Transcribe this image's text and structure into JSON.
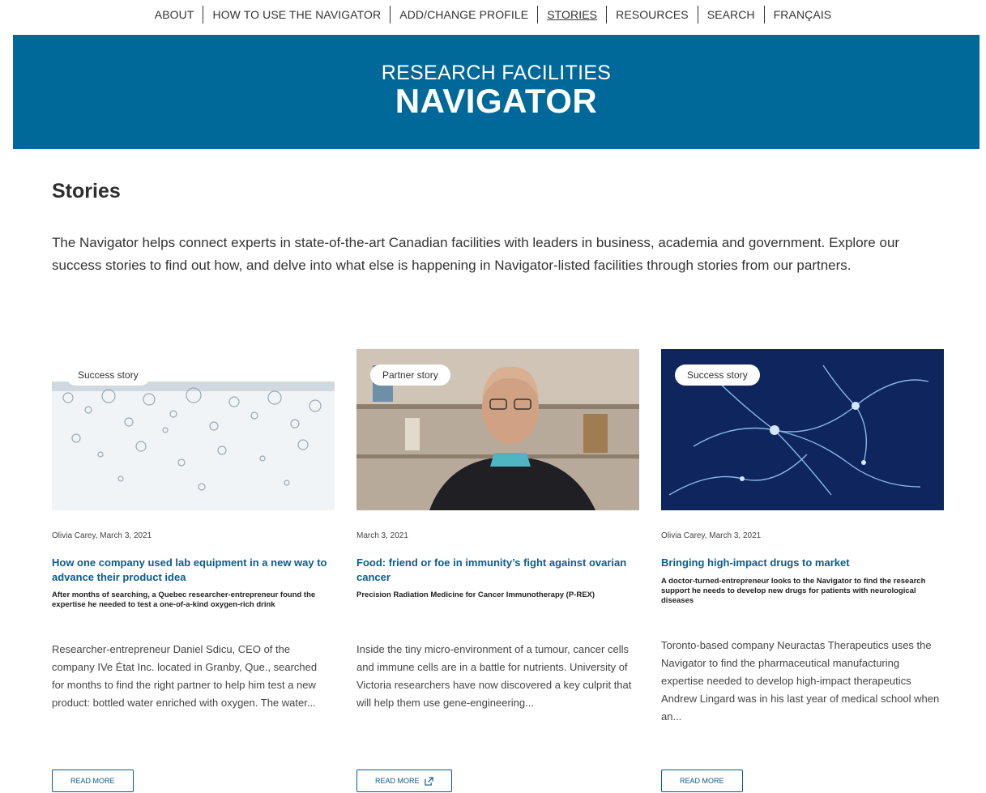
{
  "nav": {
    "items": [
      {
        "label": "ABOUT",
        "active": false
      },
      {
        "label": "HOW TO USE THE NAVIGATOR",
        "active": false
      },
      {
        "label": "ADD/CHANGE PROFILE",
        "active": false
      },
      {
        "label": "STORIES",
        "active": true
      },
      {
        "label": "RESOURCES",
        "active": false
      },
      {
        "label": "SEARCH",
        "active": false
      },
      {
        "label": "FRANÇAIS",
        "active": false
      }
    ]
  },
  "banner": {
    "line1": "RESEARCH FACILITIES",
    "line2": "NAVIGATOR",
    "color": "#00699a"
  },
  "page": {
    "title": "Stories",
    "intro": "The Navigator helps connect experts in state-of-the-art Canadian facilities with leaders in business, academia and government. Explore our success stories to find out how, and delve into what else is happening in Navigator-listed facilities through stories from our partners."
  },
  "cards": [
    {
      "badge": "Success story",
      "image": "water-bubbles-image",
      "meta": "Olivia Carey, March 3, 2021",
      "title": "How one company used lab equipment in a new way to advance their product idea",
      "subtitle": "After months of searching, a Quebec researcher-entrepreneur found the expertise he needed to test a one-of-a-kind oxygen-rich drink",
      "excerpt": "Researcher-entrepreneur Daniel Sdicu, CEO of the company IVe État Inc. located in Granby, Que., searched for months to find the right partner to help him test a new product: bottled water enriched with oxygen. The water...",
      "read_more": "READ MORE",
      "external": false
    },
    {
      "badge": "Partner story",
      "image": "researcher-portrait-image",
      "meta": "March 3, 2021",
      "title": "Food: friend or foe in immunity’s fight against ovarian cancer",
      "subtitle": "Precision Radiation Medicine for Cancer Immunotherapy (P-REX)",
      "excerpt": "Inside the tiny micro-environment of a tumour, cancer cells and immune cells are in a battle for nutrients. University of Victoria researchers have now discovered a key culprit that will help them use gene-engineering...",
      "read_more": "READ MORE",
      "external": true
    },
    {
      "badge": "Success story",
      "image": "neurons-image",
      "meta": "Olivia Carey, March 3, 2021",
      "title": "Bringing high-impact drugs to market",
      "subtitle": "A doctor-turned-entrepreneur looks to the Navigator to find the research support he needs to develop new drugs for patients with neurological diseases",
      "excerpt": "Toronto-based company Neuractas Therapeutics uses the Navigator to find the pharmaceutical manufacturing expertise needed to develop high-impact therapeutics Andrew Lingard was in his last year of medical school when an...",
      "read_more": "READ MORE",
      "external": false
    }
  ],
  "colors": {
    "link": "#0b5c8c",
    "text": "#333333"
  }
}
